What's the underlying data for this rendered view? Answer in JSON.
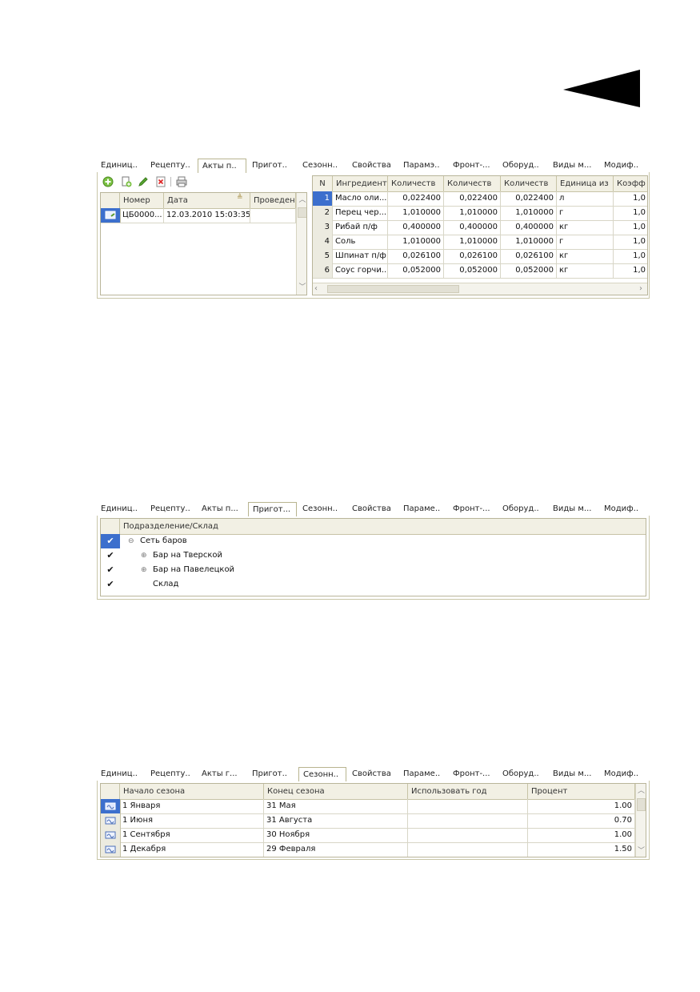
{
  "colors": {
    "selected_row": "#3c6fcd",
    "tab_border": "#b8b48f",
    "header_bg": "#f2f0e4"
  },
  "panel1": {
    "tabs": [
      "Единиц..",
      "Рецепту..",
      "Акты п..",
      "Пригот..",
      "Сезонн..",
      "Свойства",
      "Парамэ..",
      "Фронт-...",
      "Оборуд..",
      "Виды м...",
      "Модиф.."
    ],
    "active_tab": 2,
    "toolbar": [
      "add-icon",
      "copy-icon",
      "edit-icon",
      "delete-icon",
      "print-icon"
    ],
    "acts": {
      "headers": [
        "Номер",
        "Дата",
        "Проведен"
      ],
      "rows": [
        {
          "number": "ЦБ0000...",
          "date": "12.03.2010 15:03:35",
          "posted": ""
        }
      ]
    },
    "ingredients": {
      "headers": [
        "N",
        "Ингредиент",
        "Количеств",
        "Количеств",
        "Количеств",
        "Единица из",
        "Коэфф"
      ],
      "rows": [
        {
          "n": "1",
          "name": "Масло оли...",
          "q1": "0,022400",
          "q2": "0,022400",
          "q3": "0,022400",
          "unit": "л",
          "k": "1,0"
        },
        {
          "n": "2",
          "name": "Перец чер...",
          "q1": "1,010000",
          "q2": "1,010000",
          "q3": "1,010000",
          "unit": "г",
          "k": "1,0"
        },
        {
          "n": "3",
          "name": "Рибай п/ф",
          "q1": "0,400000",
          "q2": "0,400000",
          "q3": "0,400000",
          "unit": "кг",
          "k": "1,0"
        },
        {
          "n": "4",
          "name": "Соль",
          "q1": "1,010000",
          "q2": "1,010000",
          "q3": "1,010000",
          "unit": "г",
          "k": "1,0"
        },
        {
          "n": "5",
          "name": "Шпинат п/ф",
          "q1": "0,026100",
          "q2": "0,026100",
          "q3": "0,026100",
          "unit": "кг",
          "k": "1,0"
        },
        {
          "n": "6",
          "name": "Соус горчи...",
          "q1": "0,052000",
          "q2": "0,052000",
          "q3": "0,052000",
          "unit": "кг",
          "k": "1,0"
        }
      ]
    }
  },
  "panel2": {
    "tabs": [
      "Единиц..",
      "Рецепту..",
      "Акты п...",
      "Пригот...",
      "Сезонн..",
      "Свойства",
      "Параме..",
      "Фронт-...",
      "Оборуд..",
      "Виды м...",
      "Модиф.."
    ],
    "active_tab": 3,
    "header": "Подразделение/Склад",
    "tree": [
      {
        "label": "Сеть баров",
        "toggle": "⊖",
        "level": 0,
        "checked": true,
        "selected": true
      },
      {
        "label": "Бар на Тверской",
        "toggle": "⊕",
        "level": 1,
        "checked": true
      },
      {
        "label": "Бар на Павелецкой",
        "toggle": "⊕",
        "level": 1,
        "checked": true
      },
      {
        "label": "Склад",
        "toggle": "",
        "level": 1,
        "checked": true
      }
    ]
  },
  "panel3": {
    "tabs": [
      "Единиц..",
      "Рецепту..",
      "Акты г...",
      "Пригот..",
      "Сезонн..",
      "Свойства",
      "Параме..",
      "Фронт-...",
      "Оборуд..",
      "Виды м...",
      "Модиф.."
    ],
    "active_tab": 4,
    "headers": [
      "Начало сезона",
      "Конец сезона",
      "Использовать год",
      "Процент"
    ],
    "rows": [
      {
        "start": "1 Января",
        "end": "31 Мая",
        "use_year": "",
        "percent": "1.00"
      },
      {
        "start": "1 Июня",
        "end": "31 Августа",
        "use_year": "",
        "percent": "0.70"
      },
      {
        "start": "1 Сентября",
        "end": "30 Ноября",
        "use_year": "",
        "percent": "1.00"
      },
      {
        "start": "1 Декабря",
        "end": "29 Февраля",
        "use_year": "",
        "percent": "1.50"
      }
    ]
  }
}
